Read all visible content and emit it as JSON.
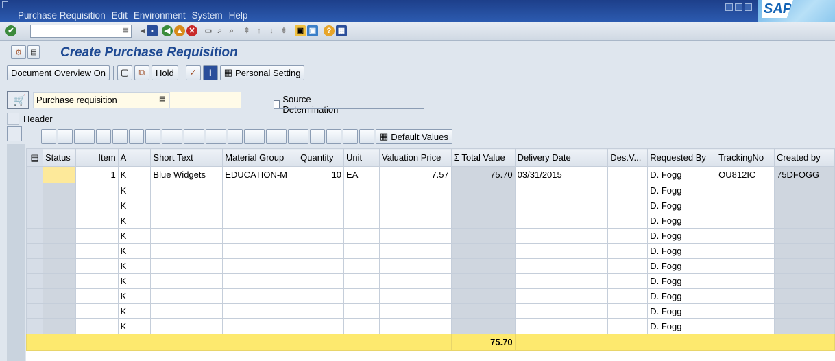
{
  "menu": [
    "Purchase Requisition",
    "Edit",
    "Environment",
    "System",
    "Help"
  ],
  "brand": "SAP",
  "title": "Create Purchase Requisition",
  "app_toolbar": {
    "document_overview": "Document Overview On",
    "hold": "Hold",
    "personal_setting": "Personal Setting"
  },
  "doc_type": {
    "value": "Purchase requisition",
    "source_determination": "Source Determination"
  },
  "header_label": "Header",
  "grid_toolbar": {
    "default_values": "Default Values"
  },
  "grid": {
    "columns": [
      "Status",
      "Item",
      "A",
      "Short Text",
      "Material Group",
      "Quantity",
      "Unit",
      "Valuation Price",
      "Σ Total Value",
      "Delivery Date",
      "Des.V...",
      "Requested By",
      "TrackingNo",
      "Created by"
    ],
    "rows": [
      {
        "status": "",
        "item": "1",
        "a": "K",
        "short_text": "Blue Widgets",
        "material_group": "EDUCATION-M",
        "quantity": "10",
        "unit": "EA",
        "valuation_price": "7.57",
        "total_value": "75.70",
        "delivery_date": "03/31/2015",
        "des_v": "",
        "requested_by": "D. Fogg",
        "tracking_no": "OU812IC",
        "created_by": "75DFOGG"
      },
      {
        "a": "K",
        "requested_by": "D. Fogg"
      },
      {
        "a": "K",
        "requested_by": "D. Fogg"
      },
      {
        "a": "K",
        "requested_by": "D. Fogg"
      },
      {
        "a": "K",
        "requested_by": "D. Fogg"
      },
      {
        "a": "K",
        "requested_by": "D. Fogg"
      },
      {
        "a": "K",
        "requested_by": "D. Fogg"
      },
      {
        "a": "K",
        "requested_by": "D. Fogg"
      },
      {
        "a": "K",
        "requested_by": "D. Fogg"
      },
      {
        "a": "K",
        "requested_by": "D. Fogg"
      },
      {
        "a": "K",
        "requested_by": "D. Fogg"
      }
    ],
    "total": "75.70"
  }
}
